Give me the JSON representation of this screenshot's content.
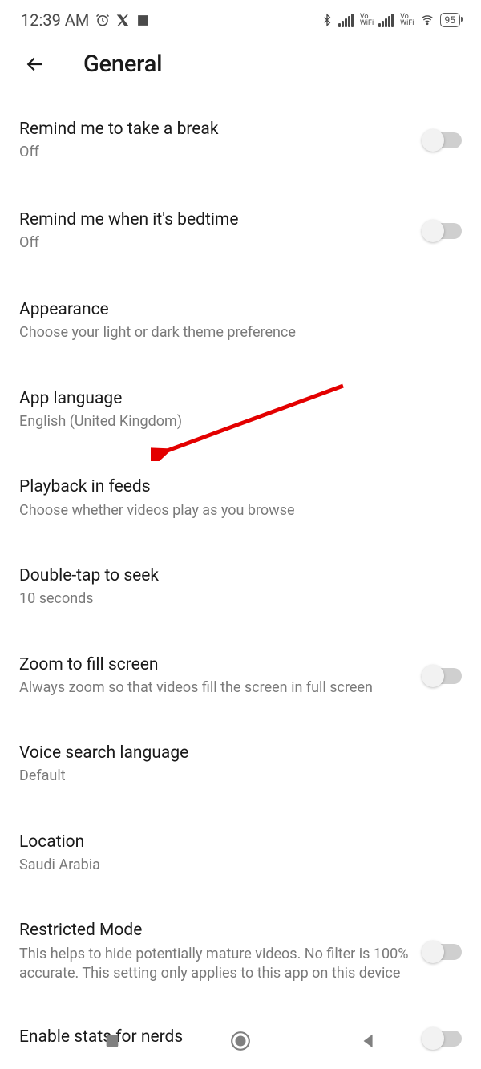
{
  "status": {
    "time": "12:39 AM",
    "battery": "95"
  },
  "header": {
    "title": "General"
  },
  "settings": {
    "break": {
      "label": "Remind me to take a break",
      "sub": "Off"
    },
    "bedtime": {
      "label": "Remind me when it's bedtime",
      "sub": "Off"
    },
    "appearance": {
      "label": "Appearance",
      "sub": "Choose your light or dark theme preference"
    },
    "language": {
      "label": "App language",
      "sub": "English (United Kingdom)"
    },
    "playback": {
      "label": "Playback in feeds",
      "sub": "Choose whether videos play as you browse"
    },
    "seek": {
      "label": "Double-tap to seek",
      "sub": "10 seconds"
    },
    "zoom": {
      "label": "Zoom to fill screen",
      "sub": "Always zoom so that videos fill the screen in full screen"
    },
    "voice": {
      "label": "Voice search language",
      "sub": "Default"
    },
    "location": {
      "label": "Location",
      "sub": "Saudi Arabia"
    },
    "restricted": {
      "label": "Restricted Mode",
      "sub": "This helps to hide potentially mature videos. No filter is 100% accurate. This setting only applies to this app on this device"
    },
    "stats": {
      "label": "Enable stats for nerds"
    }
  }
}
